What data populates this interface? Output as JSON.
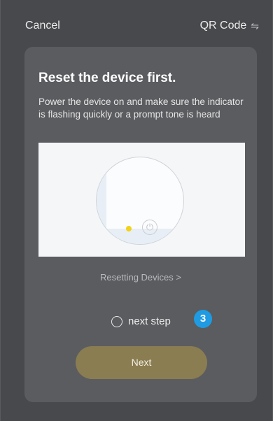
{
  "header": {
    "cancel_label": "Cancel",
    "qr_label": "QR Code",
    "qr_icon": "⇋"
  },
  "card": {
    "title": "Reset the device first.",
    "subtitle": "Power the device on and make sure the indicator is flashing quickly or a prompt tone is heard",
    "reset_link": "Resetting Devices >",
    "step_label": "next step",
    "badge": "3",
    "next_label": "Next"
  },
  "colors": {
    "background": "#48494c",
    "card": "#5b5c5f",
    "button": "#8a7d52",
    "badge": "#1f9be3",
    "indicator": "#f2d21a"
  }
}
